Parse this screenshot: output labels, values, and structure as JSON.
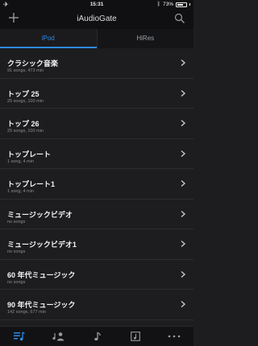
{
  "status": {
    "time": "15:31",
    "battery_percent": "73%",
    "battery_level": 0.73,
    "airplane_icon": "airplane-icon",
    "bluetooth_icon": "bluetooth-icon"
  },
  "nav": {
    "title": "iAudioGate",
    "add_icon": "plus-icon",
    "search_icon": "search-icon"
  },
  "tabs": [
    {
      "label": "iPod",
      "active": true
    },
    {
      "label": "HiRes",
      "active": false
    }
  ],
  "playlists": [
    {
      "name": "クラシック音楽",
      "meta": "91 songs, 473 min"
    },
    {
      "name": "トップ 25",
      "meta": "25 songs, 100 min"
    },
    {
      "name": "トップ 26",
      "meta": "25 songs, 100 min"
    },
    {
      "name": "トップレート",
      "meta": "1 song, 4 min"
    },
    {
      "name": "トップレート1",
      "meta": "1 song, 4 min"
    },
    {
      "name": "ミュージックビデオ",
      "meta": "no songs"
    },
    {
      "name": "ミュージックビデオ1",
      "meta": "no songs"
    },
    {
      "name": "60 年代ミュージック",
      "meta": "no songs"
    },
    {
      "name": "90 年代ミュージック",
      "meta": "142 songs, 677 min"
    }
  ],
  "tabbar": [
    {
      "icon": "playlist-icon",
      "active": true
    },
    {
      "icon": "artist-icon",
      "active": false
    },
    {
      "icon": "music-note-icon",
      "active": false
    },
    {
      "icon": "album-icon",
      "active": false
    },
    {
      "icon": "more-icon",
      "active": false
    }
  ],
  "colors": {
    "accent": "#2b8be6",
    "background": "#1d1d1f",
    "bar": "#101012"
  }
}
